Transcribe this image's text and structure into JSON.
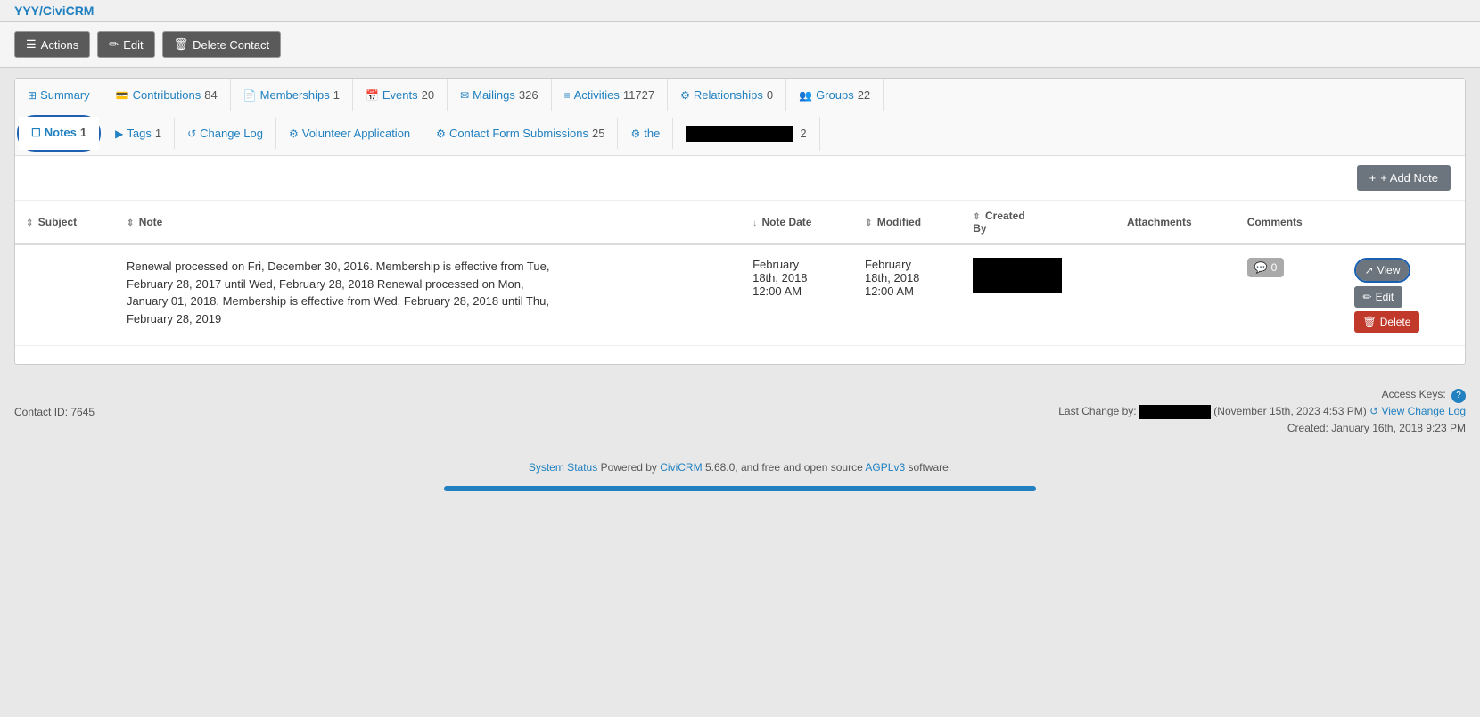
{
  "header": {
    "title": "YYY/CiviCRM"
  },
  "toolbar": {
    "actions_label": "Actions",
    "edit_label": "Edit",
    "delete_label": "Delete Contact"
  },
  "tabs_row1": [
    {
      "id": "summary",
      "icon": "⊞",
      "label": "Summary",
      "count": ""
    },
    {
      "id": "contributions",
      "icon": "💳",
      "label": "Contributions",
      "count": "84"
    },
    {
      "id": "memberships",
      "icon": "📄",
      "label": "Memberships",
      "count": "1"
    },
    {
      "id": "events",
      "icon": "📅",
      "label": "Events",
      "count": "20"
    },
    {
      "id": "mailings",
      "icon": "✉",
      "label": "Mailings",
      "count": "326"
    },
    {
      "id": "activities",
      "icon": "≡",
      "label": "Activities",
      "count": "11727"
    },
    {
      "id": "relationships",
      "icon": "⚙",
      "label": "Relationships",
      "count": "0"
    },
    {
      "id": "groups",
      "icon": "👥",
      "label": "Groups",
      "count": "22"
    }
  ],
  "tabs_row2": [
    {
      "id": "notes",
      "icon": "☐",
      "label": "Notes",
      "count": "1",
      "active": true,
      "circled": true
    },
    {
      "id": "tags",
      "icon": "▶",
      "label": "Tags",
      "count": "1",
      "active": false
    },
    {
      "id": "changelog",
      "icon": "↺",
      "label": "Change Log",
      "count": "",
      "active": false
    },
    {
      "id": "volunteer",
      "icon": "⚙",
      "label": "Volunteer Application",
      "count": "",
      "active": false
    },
    {
      "id": "contactform",
      "icon": "⚙",
      "label": "Contact Form Submissions",
      "count": "25",
      "active": false
    },
    {
      "id": "the",
      "icon": "⚙",
      "label": "the",
      "count": "",
      "active": false
    },
    {
      "id": "redacted",
      "icon": "",
      "label": "",
      "count": "2",
      "active": false,
      "redacted": true
    }
  ],
  "add_note_label": "+ Add Note",
  "table": {
    "columns": [
      {
        "id": "subject",
        "label": "Subject",
        "sortable": true
      },
      {
        "id": "note",
        "label": "Note",
        "sortable": true
      },
      {
        "id": "note_date",
        "label": "Note Date",
        "sortable": true,
        "sorted": true
      },
      {
        "id": "modified",
        "label": "Modified",
        "sortable": true
      },
      {
        "id": "created_by",
        "label": "Created By",
        "sortable": true
      },
      {
        "id": "attachments",
        "label": "Attachments",
        "sortable": false
      },
      {
        "id": "comments",
        "label": "Comments",
        "sortable": false
      }
    ],
    "rows": [
      {
        "subject": "",
        "note": "Renewal processed on Fri, December 30, 2016. Membership is effective from Tue, February 28, 2017 until Wed, February 28, 2018 Renewal processed on Mon, January 01, 2018. Membership is effective from Wed, February 28, 2018 until Thu, February 28, 2019",
        "note_date": "February 18th, 2018 12:00 AM",
        "modified": "February 18th, 2018 12:00 AM",
        "created_by_redacted": true,
        "attachments": "",
        "comments_count": "0"
      }
    ]
  },
  "row_actions": {
    "view_label": "View",
    "edit_label": "Edit",
    "delete_label": "Delete"
  },
  "footer": {
    "contact_id_label": "Contact ID:",
    "contact_id": "7645",
    "last_change_label": "Last Change by:",
    "last_change_date": "(November 15th, 2023 4:53 PM)",
    "view_change_log": "View Change Log",
    "created_label": "Created: January 16th, 2018 9:23 PM",
    "access_keys_label": "Access Keys:",
    "help_icon": "?"
  },
  "page_footer": {
    "system_status": "System Status",
    "powered_text": "Powered by",
    "civicrm_link": "CiviCRM",
    "version": "5.68.0, and free and open source",
    "agpl_link": "AGPLv3",
    "software_text": "software."
  }
}
